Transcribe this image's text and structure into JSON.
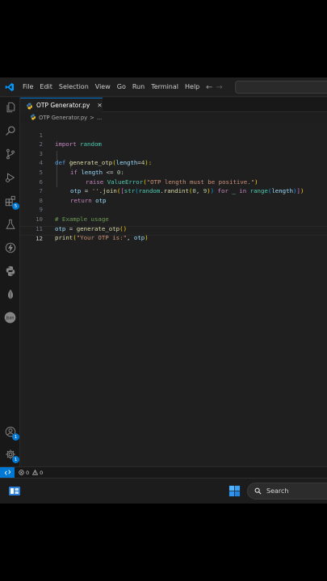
{
  "menu": [
    "File",
    "Edit",
    "Selection",
    "View",
    "Go",
    "Run",
    "Terminal",
    "Help"
  ],
  "tab": {
    "label": "OTP Generator.py",
    "close": "✕"
  },
  "breadcrumb": {
    "file": "OTP Generator.py",
    "sep": ">",
    "more": "..."
  },
  "editor": {
    "active_line": 12,
    "lines": [
      {
        "n": "1"
      },
      {
        "n": "2"
      },
      {
        "n": "3"
      },
      {
        "n": "4"
      },
      {
        "n": "5"
      },
      {
        "n": "6"
      },
      {
        "n": "7"
      },
      {
        "n": "8"
      },
      {
        "n": "9"
      },
      {
        "n": "10"
      },
      {
        "n": "11"
      },
      {
        "n": "12"
      }
    ],
    "code": {
      "l1": [
        "import",
        " random"
      ],
      "l3": [
        "def",
        " ",
        "generate_otp",
        "(",
        "length",
        "=",
        "4",
        "):"
      ],
      "l4": [
        "if",
        " ",
        "length",
        " <= ",
        "0",
        ":"
      ],
      "l5": [
        "raise",
        " ",
        "ValueError",
        "(",
        "\"OTP length must be positive.\"",
        ")"
      ],
      "l6": [
        "otp",
        " = ",
        "''",
        ".",
        "join",
        "(",
        "[",
        "str",
        "(",
        "random",
        ".",
        "randint",
        "(",
        "0",
        ", ",
        "9",
        ")",
        ")",
        " ",
        "for",
        " ",
        "_",
        " ",
        "in",
        " ",
        "range",
        "(",
        "length",
        ")",
        "]",
        ")"
      ],
      "l7": [
        "return",
        " ",
        "otp"
      ],
      "l9": [
        "# Example usage"
      ],
      "l10": [
        "otp",
        " = ",
        "generate_otp",
        "(",
        ")"
      ],
      "l11": [
        "print",
        "(",
        "\"Your OTP is:\"",
        ", ",
        "otp",
        ")"
      ]
    }
  },
  "activity_badges": {
    "extensions": "5",
    "accounts": "1",
    "settings": "1"
  },
  "activity_icons": [
    "explorer-icon",
    "search-icon",
    "source-control-icon",
    "run-debug-icon",
    "extensions-icon",
    "testing-icon",
    "lightning-icon",
    "python-icon",
    "mongodb-leaf-icon",
    "json-icon",
    "accounts-icon",
    "settings-gear-icon"
  ],
  "json_icon_label": "Json",
  "status": {
    "errors": "0",
    "warnings": "0"
  },
  "taskbar": {
    "search_label": "Search"
  },
  "colors": {
    "accent": "#0078d4",
    "editor_bg": "#1f1f1f",
    "keyword": "#569cd6",
    "string": "#ce9178",
    "function": "#dcdcaa",
    "comment": "#6a9955"
  }
}
